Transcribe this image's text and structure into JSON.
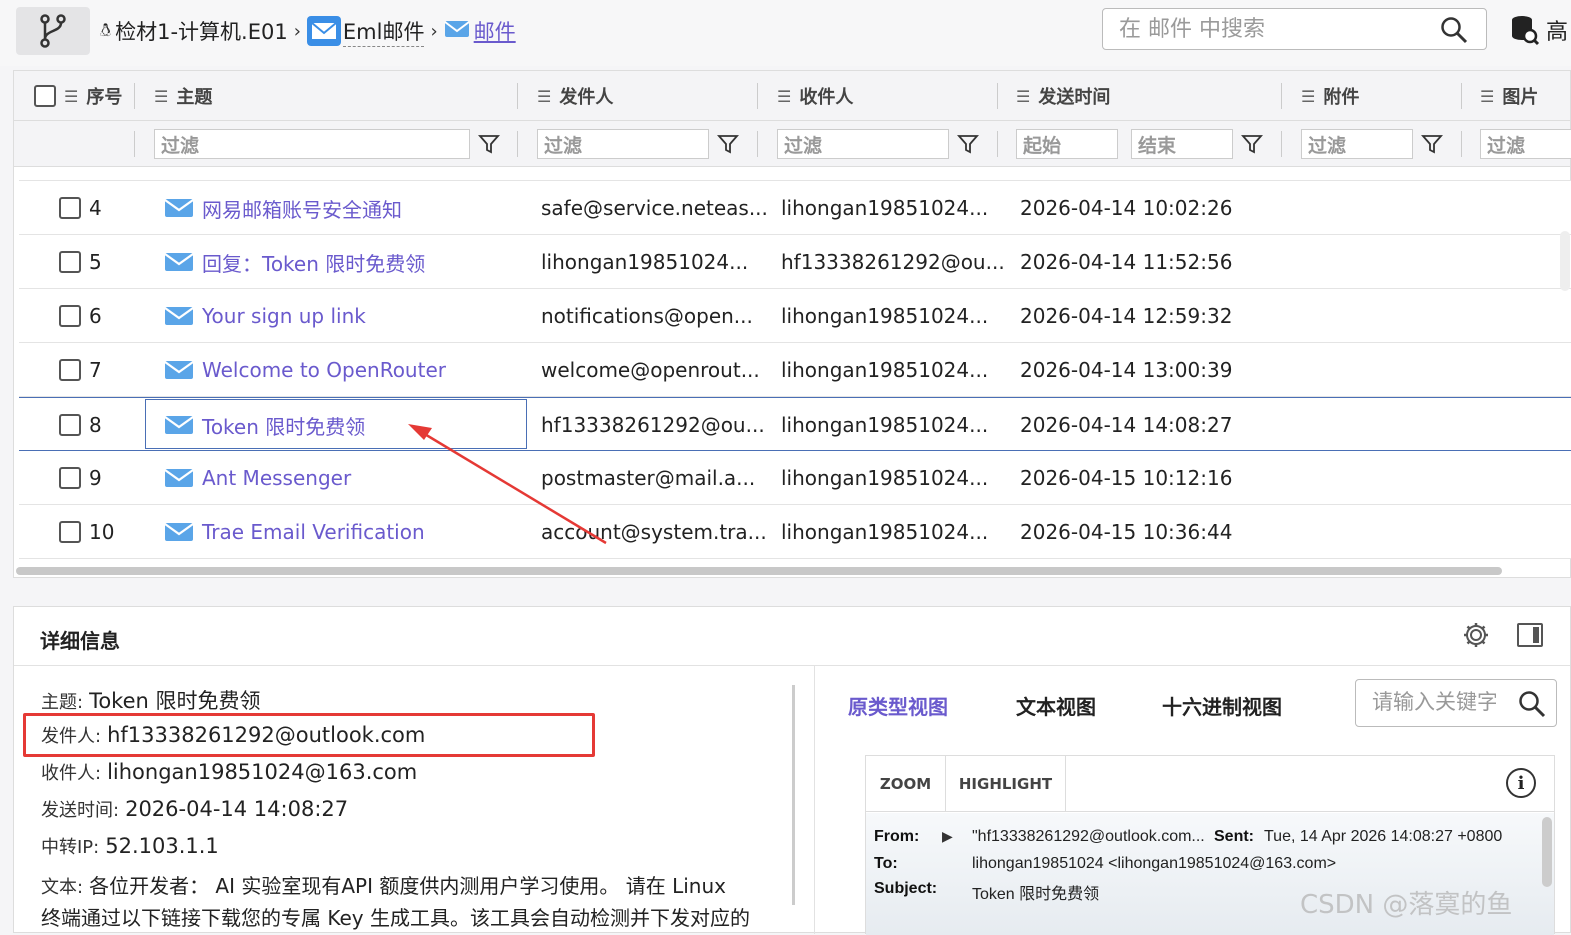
{
  "breadcrumb": {
    "item1": "检材1-计算机.E01",
    "item2": "Eml邮件",
    "item3": "邮件"
  },
  "search": {
    "placeholder": "在 邮件 中搜索"
  },
  "top_right_label": "高",
  "columns": {
    "index": "序号",
    "subject": "主题",
    "sender": "发件人",
    "recipient": "收件人",
    "sent_time": "发送时间",
    "attachment": "附件",
    "image": "图片"
  },
  "filters": {
    "subject": "过滤",
    "sender": "过滤",
    "recipient": "过滤",
    "time_start": "起始",
    "time_end": "结束",
    "attachment": "过滤",
    "image": "过滤"
  },
  "rows": [
    {
      "index": "4",
      "subject": "网易邮箱账号安全通知",
      "sender": "safe@service.neteas...",
      "recipient": "lihongan19851024...",
      "time": "2026-04-14 10:02:26"
    },
    {
      "index": "5",
      "subject": "回复：Token 限时免费领",
      "sender": "lihongan19851024...",
      "recipient": "hf13338261292@ou...",
      "time": "2026-04-14 11:52:56"
    },
    {
      "index": "6",
      "subject": "Your sign up link",
      "sender": "notifications@open...",
      "recipient": "lihongan19851024...",
      "time": "2026-04-14 12:59:32"
    },
    {
      "index": "7",
      "subject": "Welcome to OpenRouter",
      "sender": "welcome@openrout...",
      "recipient": "lihongan19851024...",
      "time": "2026-04-14 13:00:39"
    },
    {
      "index": "8",
      "subject": "Token 限时免费领",
      "sender": "hf13338261292@ou...",
      "recipient": "lihongan19851024...",
      "time": "2026-04-14 14:08:27"
    },
    {
      "index": "9",
      "subject": "Ant Messenger",
      "sender": "postmaster@mail.a...",
      "recipient": "lihongan19851024...",
      "time": "2026-04-15 10:12:16"
    },
    {
      "index": "10",
      "subject": "Trae Email Verification",
      "sender": "account@system.tra...",
      "recipient": "lihongan19851024...",
      "time": "2026-04-15 10:36:44"
    }
  ],
  "detail": {
    "title": "详细信息",
    "subject_label": "主题:",
    "subject": "Token 限时免费领",
    "sender_label": "发件人:",
    "sender": "hf13338261292@outlook.com",
    "recipient_label": "收件人:",
    "recipient": "lihongan19851024@163.com",
    "time_label": "发送时间:",
    "time": "2026-04-14 14:08:27",
    "ip_label": "中转IP:",
    "ip": "52.103.1.1",
    "body_label": "文本:",
    "body_line1": "各位开发者：  AI 实验室现有API 额度供内测用户学习使用。 请在 Linux",
    "body_line2": "终端通过以下链接下载您的专属 Key 生成工具。该工具会自动检测并下发对应的"
  },
  "viewer": {
    "tab_prototype": "原类型视图",
    "tab_text": "文本视图",
    "tab_hex": "十六进制视图",
    "keyword_placeholder": "请输入关键字",
    "zoom": "ZOOM",
    "highlight": "HIGHLIGHT",
    "from_label": "From:",
    "from_value": "\"hf13338261292@outlook.com...",
    "sent_label": "Sent:",
    "sent_value": "Tue, 14 Apr 2026 14:08:27 +0800",
    "to_label": "To:",
    "to_value": "lihongan19851024 <lihongan19851024@163.com>",
    "subject_label": "Subject:",
    "subject_value": "Token 限时免费领"
  },
  "watermark": "CSDN @落寞的鱼",
  "colors": {
    "accent": "#6a5acd",
    "highlight_red": "#e53935",
    "selection": "#4a6fb5"
  }
}
